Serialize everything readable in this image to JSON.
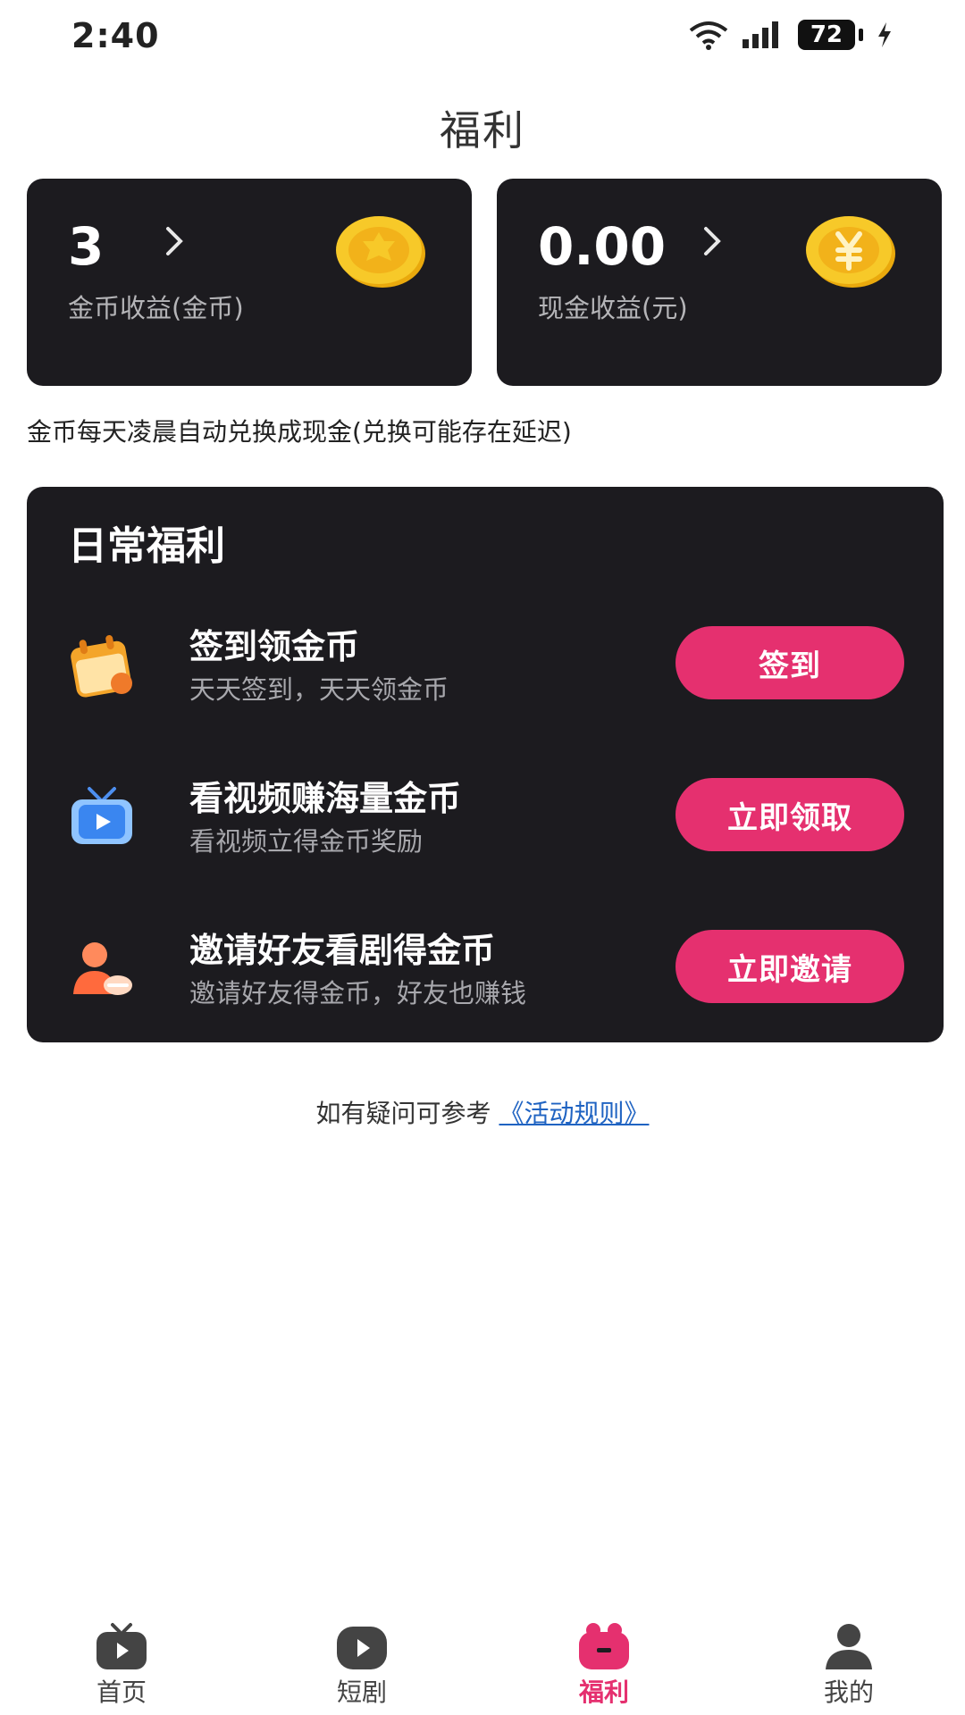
{
  "status_bar": {
    "time": "2:40",
    "battery": "72"
  },
  "page": {
    "title": "福利"
  },
  "earnings": {
    "coins": {
      "value": "3",
      "label": "金币收益(金币)"
    },
    "cash": {
      "value": "0.00",
      "label": "现金收益(元)"
    }
  },
  "notice": "金币每天凌晨自动兑换成现金(兑换可能存在延迟)",
  "daily": {
    "title": "日常福利",
    "tasks": [
      {
        "title": "签到领金币",
        "subtitle": "天天签到，天天领金币",
        "button": "签到",
        "icon": "calendar-icon"
      },
      {
        "title": "看视频赚海量金币",
        "subtitle": "看视频立得金币奖励",
        "button": "立即领取",
        "icon": "tv-icon"
      },
      {
        "title": "邀请好友看剧得金币",
        "subtitle": "邀请好友得金币，好友也赚钱",
        "button": "立即邀请",
        "icon": "invite-person-icon"
      }
    ]
  },
  "rules": {
    "prefix": "如有疑问可参考",
    "link": "《活动规则》"
  },
  "nav": [
    {
      "label": "首页",
      "icon": "home-tv-icon",
      "active": false
    },
    {
      "label": "短剧",
      "icon": "play-icon",
      "active": false
    },
    {
      "label": "福利",
      "icon": "gift-icon",
      "active": true
    },
    {
      "label": "我的",
      "icon": "profile-icon",
      "active": false
    }
  ],
  "colors": {
    "accent": "#e5306f",
    "card": "#1c1b1f",
    "link": "#1f63c2",
    "coin": "#f5c518"
  }
}
